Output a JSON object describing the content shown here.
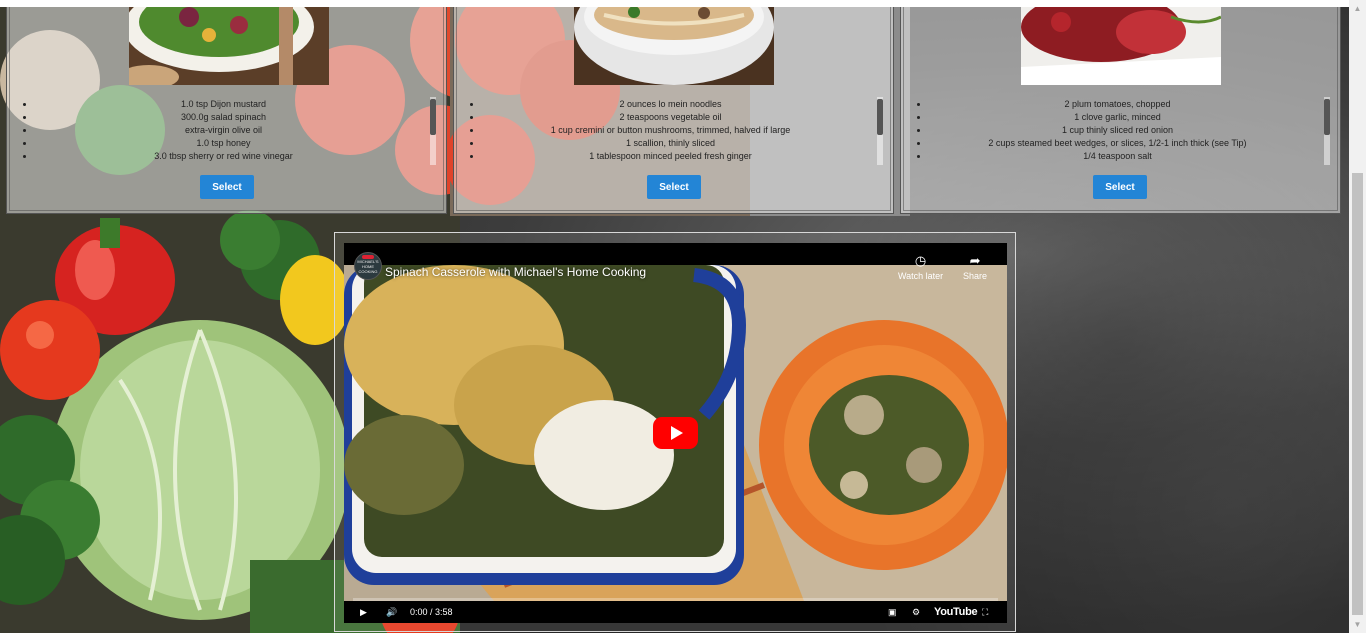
{
  "recipes": [
    {
      "ingredients": [
        "1.0 tsp Dijon mustard",
        "300.0g salad spinach",
        "extra-virgin olive oil",
        "1.0 tsp honey",
        "3.0 tbsp sherry or red wine vinegar"
      ],
      "select_label": "Select"
    },
    {
      "ingredients": [
        "2 ounces lo mein noodles",
        "2 teaspoons vegetable oil",
        "1 cup cremini or button mushrooms, trimmed, halved if large",
        "1 scallion, thinly sliced",
        "1 tablespoon minced peeled fresh ginger"
      ],
      "select_label": "Select"
    },
    {
      "ingredients": [
        "2 plum tomatoes, chopped",
        "1 clove garlic, minced",
        "1 cup thinly sliced red onion",
        "2 cups steamed beet wedges, or slices, 1/2-1 inch thick (see Tip)",
        "1/4 teaspoon salt"
      ],
      "select_label": "Select"
    }
  ],
  "video": {
    "title": "Spinach Casserole with Michael's Home Cooking",
    "channel_logo_text": "MICHAEL'S HOME COOKING",
    "watch_later_label": "Watch later",
    "share_label": "Share",
    "time": "0:00 / 3:58",
    "youtube_label": "YouTube"
  },
  "colors": {
    "select_button": "#2385d6",
    "play_button": "#ff0000"
  }
}
